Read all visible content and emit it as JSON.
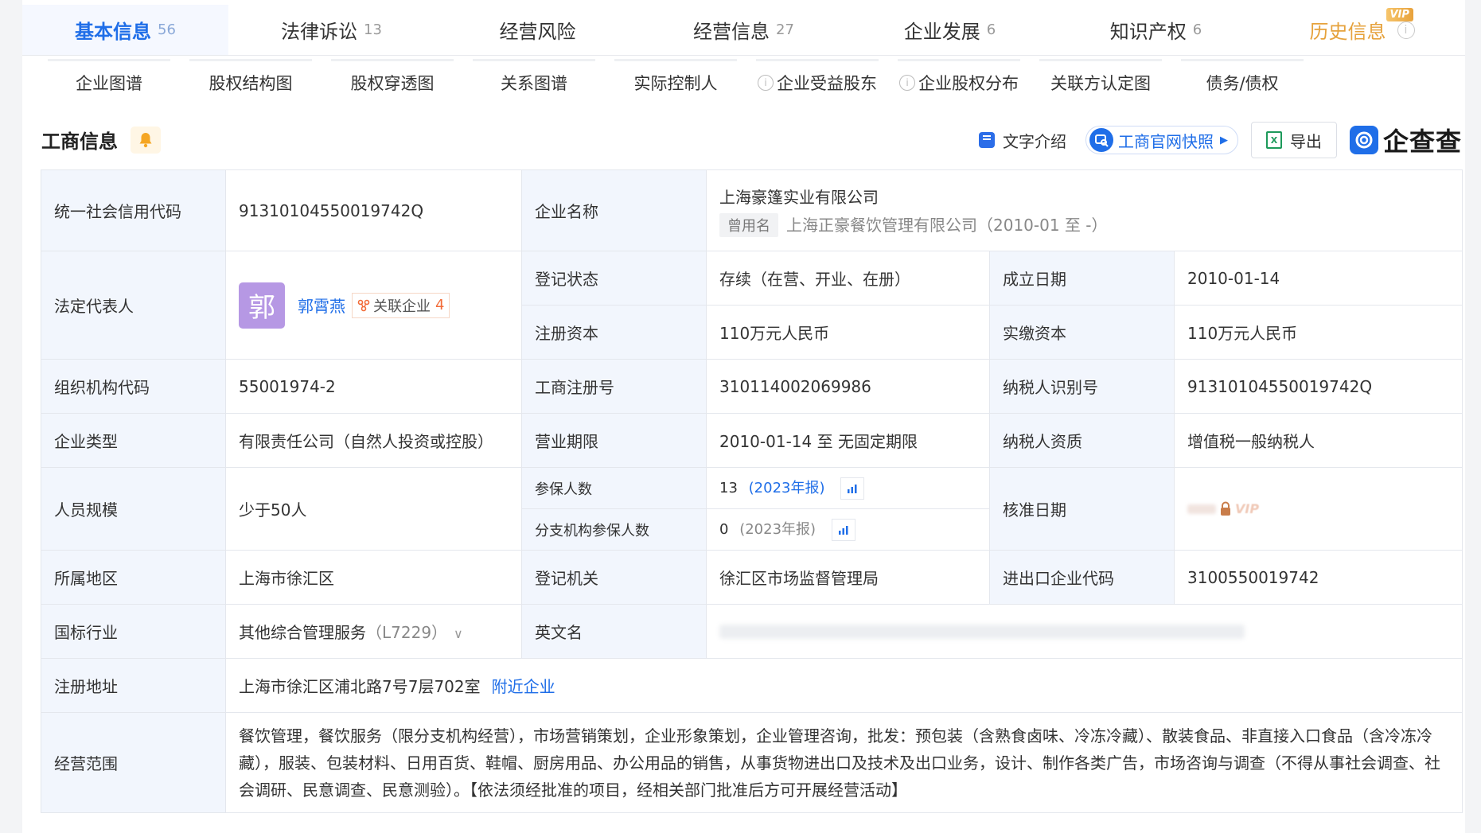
{
  "main_tabs": [
    {
      "label": "基本信息",
      "count": "56"
    },
    {
      "label": "法律诉讼",
      "count": "13"
    },
    {
      "label": "经营风险",
      "count": ""
    },
    {
      "label": "经营信息",
      "count": "27"
    },
    {
      "label": "企业发展",
      "count": "6"
    },
    {
      "label": "知识产权",
      "count": "6"
    },
    {
      "label": "历史信息",
      "count": "",
      "badge": "VIP"
    }
  ],
  "sub_tabs": [
    "企业图谱",
    "股权结构图",
    "股权穿透图",
    "关系图谱",
    "实际控制人",
    "企业受益股东",
    "企业股权分布",
    "关联方认定图",
    "债务/债权"
  ],
  "section": {
    "title": "工商信息"
  },
  "toolbar": {
    "text_intro": "文字介绍",
    "official_snapshot": "工商官网快照",
    "export": "导出",
    "logo": "企查查"
  },
  "info": {
    "credit_code_label": "统一社会信用代码",
    "credit_code": "91310104550019742Q",
    "company_name_label": "企业名称",
    "company_name": "上海豪篷实业有限公司",
    "former_name_tag": "曾用名",
    "former_name": "上海正豪餐饮管理有限公司（2010-01 至 -）",
    "legal_rep_label": "法定代表人",
    "legal_rep_avatar": "郭",
    "legal_rep_name": "郭霄燕",
    "related_label": "关联企业",
    "related_count": "4",
    "reg_status_label": "登记状态",
    "reg_status": "存续（在营、开业、在册）",
    "founded_label": "成立日期",
    "founded": "2010-01-14",
    "reg_capital_label": "注册资本",
    "reg_capital": "110万元人民币",
    "paid_capital_label": "实缴资本",
    "paid_capital": "110万元人民币",
    "org_code_label": "组织机构代码",
    "org_code": "55001974-2",
    "biz_reg_no_label": "工商注册号",
    "biz_reg_no": "310114002069986",
    "taxpayer_id_label": "纳税人识别号",
    "taxpayer_id": "91310104550019742Q",
    "company_type_label": "企业类型",
    "company_type": "有限责任公司（自然人投资或控股）",
    "biz_term_label": "营业期限",
    "biz_term": "2010-01-14 至 无固定期限",
    "taxpayer_qual_label": "纳税人资质",
    "taxpayer_qual": "增值税一般纳税人",
    "staff_size_label": "人员规模",
    "staff_size": "少于50人",
    "insured_label": "参保人数",
    "insured_value": "13",
    "insured_year": "(2023年报)",
    "branch_insured_label": "分支机构参保人数",
    "branch_insured_value": "0",
    "branch_insured_year": "(2023年报)",
    "approval_date_label": "核准日期",
    "approval_vip": "VIP",
    "region_label": "所属地区",
    "region": "上海市徐汇区",
    "reg_authority_label": "登记机关",
    "reg_authority": "徐汇区市场监督管理局",
    "import_export_label": "进出口企业代码",
    "import_export": "3100550019742",
    "industry_label": "国标行业",
    "industry": "其他综合管理服务",
    "industry_code": "（L7229）",
    "english_name_label": "英文名",
    "reg_address_label": "注册地址",
    "reg_address": "上海市徐汇区浦北路7号7层702室",
    "nearby_link": "附近企业",
    "scope_label": "经营范围",
    "scope": "餐饮管理，餐饮服务（限分支机构经营），市场营销策划，企业形象策划，企业管理咨询，批发：预包装（含熟食卤味、冷冻冷藏）、散装食品、非直接入口食品（含冷冻冷藏），服装、包装材料、日用百货、鞋帽、厨房用品、办公用品的销售，从事货物进出口及技术及出口业务，设计、制作各类广告，市场咨询与调查（不得从事社会调查、社会调研、民意调查、民意测验）。【依法须经批准的项目，经相关部门批准后方可开展经营活动】"
  },
  "colors": {
    "accent": "#1f6ee8",
    "label_bg": "#f2f6fd",
    "history": "#e6a23c",
    "avatar": "#b698e4",
    "related_count": "#f26b38"
  }
}
